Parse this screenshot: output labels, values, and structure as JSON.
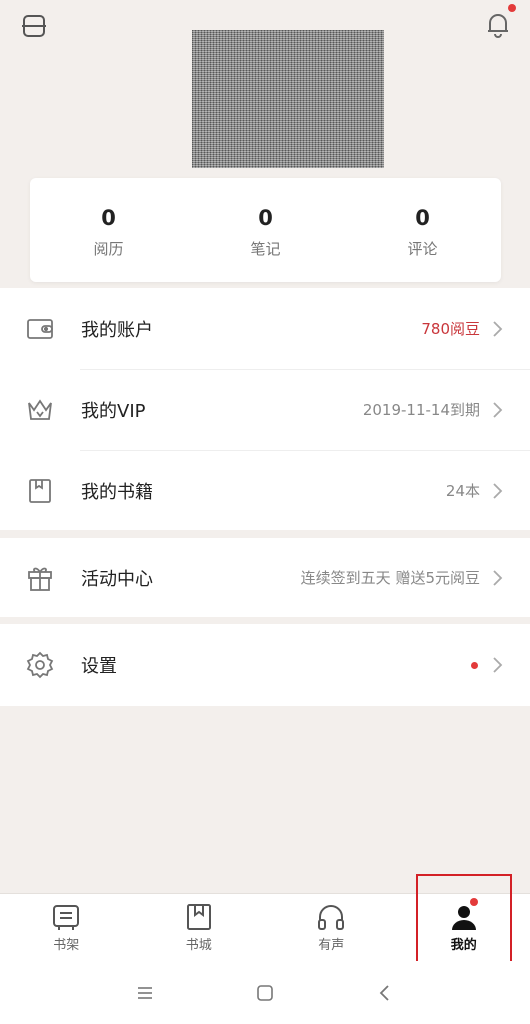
{
  "header": {
    "scan_icon": "scan-icon",
    "bell_icon": "bell-icon",
    "bell_has_dot": true
  },
  "stats": [
    {
      "value": "0",
      "label": "阅历"
    },
    {
      "value": "0",
      "label": "笔记"
    },
    {
      "value": "0",
      "label": "评论"
    }
  ],
  "menu": {
    "account": {
      "label": "我的账户",
      "value": "780阅豆",
      "icon": "wallet-icon"
    },
    "vip": {
      "label": "我的VIP",
      "value": "2019-11-14到期",
      "icon": "crown-icon"
    },
    "books": {
      "label": "我的书籍",
      "value": "24本",
      "icon": "book-icon"
    },
    "activity": {
      "label": "活动中心",
      "value": "连续签到五天 赠送5元阅豆",
      "icon": "gift-icon"
    },
    "settings": {
      "label": "设置",
      "icon": "settings-icon",
      "has_dot": true
    }
  },
  "tabs": [
    {
      "label": "书架",
      "icon": "bookshelf-icon"
    },
    {
      "label": "书城",
      "icon": "bookstore-icon"
    },
    {
      "label": "有声",
      "icon": "headphones-icon"
    },
    {
      "label": "我的",
      "icon": "profile-icon",
      "active": true,
      "has_dot": true
    }
  ],
  "colors": {
    "accent_red": "#e33a3a",
    "value_red": "#c9363b",
    "highlight_box": "#d32026",
    "background": "#f3efec"
  }
}
